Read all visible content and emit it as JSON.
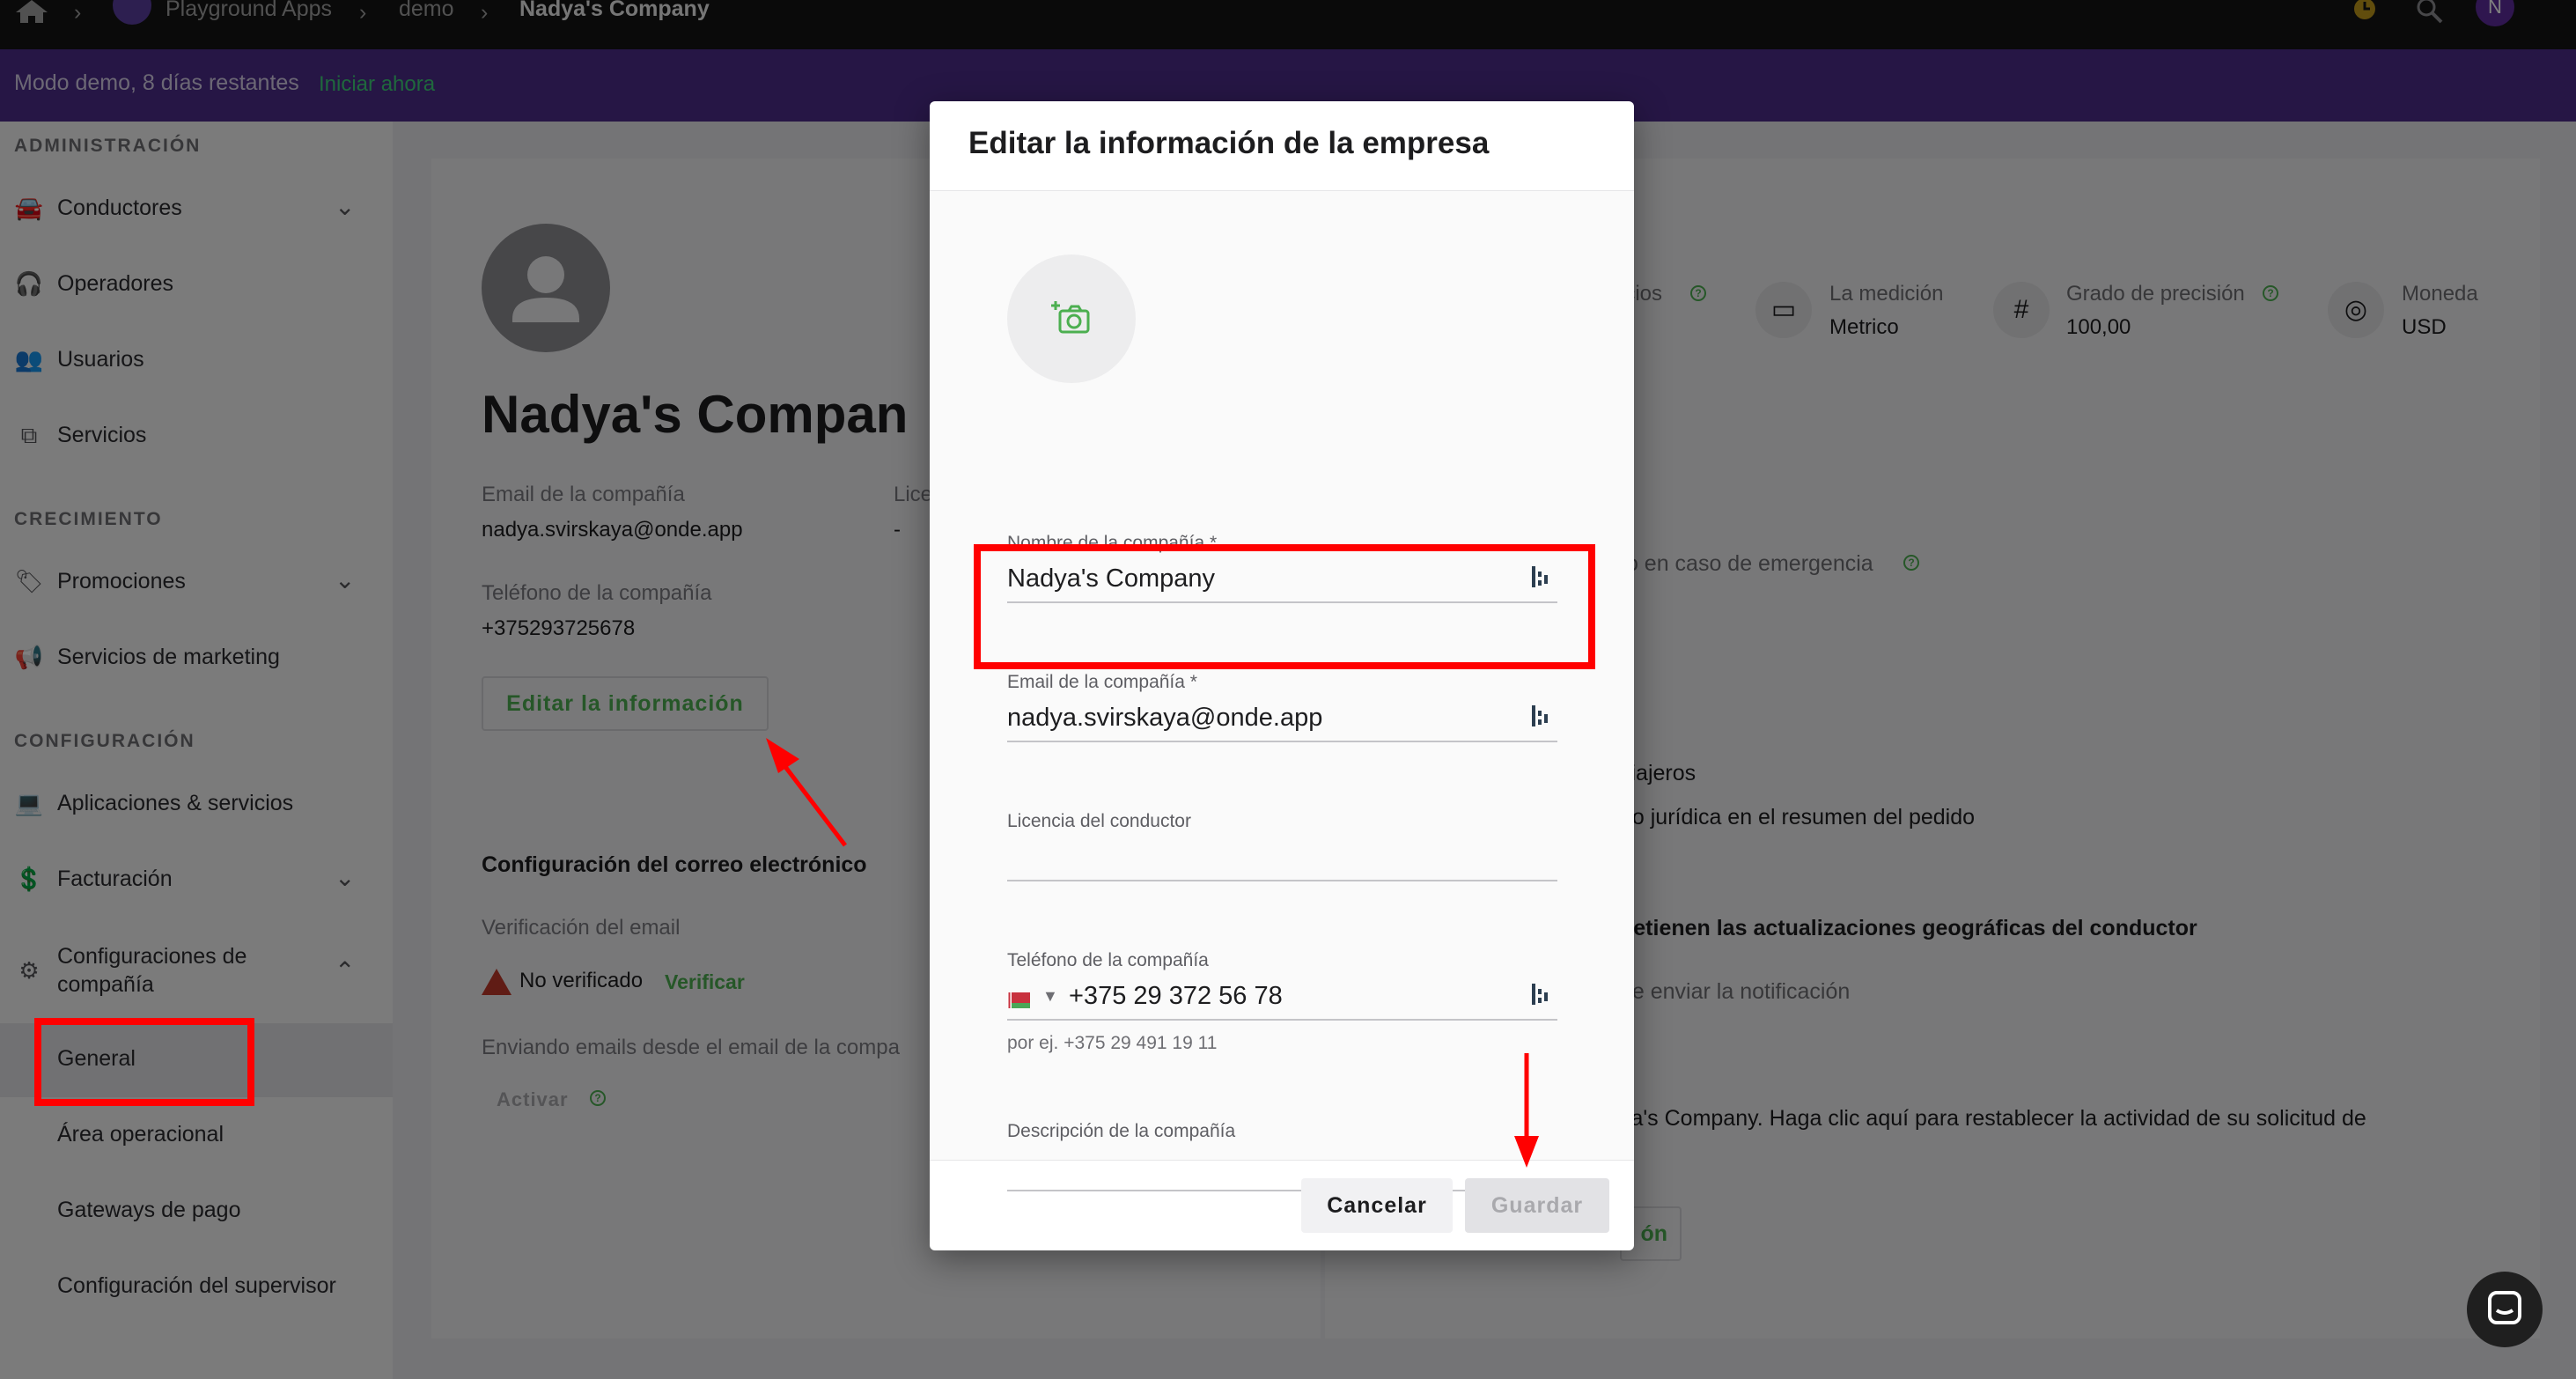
{
  "topbar": {
    "breadcrumb": [
      {
        "label": "Playground Apps"
      },
      {
        "label": "demo"
      },
      {
        "label": "Nadya's Company"
      }
    ],
    "avatar_initial": "N"
  },
  "banner": {
    "text": "Modo demo, 8 días restantes",
    "link": "Iniciar ahora"
  },
  "sidebar": {
    "sections": [
      {
        "title": "ADMINISTRACIÓN"
      },
      {
        "title": "CRECIMIENTO"
      },
      {
        "title": "CONFIGURACIÓN"
      }
    ],
    "items": {
      "conductores": "Conductores",
      "operadores": "Operadores",
      "usuarios": "Usuarios",
      "servicios": "Servicios",
      "promociones": "Promociones",
      "marketing": "Servicios de marketing",
      "aplicaciones": "Aplicaciones & servicios",
      "facturacion": "Facturación",
      "config_compania_1": "Configuraciones de",
      "config_compania_2": "compañía",
      "general": "General",
      "area": "Área operacional",
      "gateways": "Gateways de pago",
      "supervisor": "Configuración del supervisor"
    }
  },
  "page": {
    "company_name": "Nadya's Compan",
    "email_label": "Email de la compañía",
    "email_value": "nadya.svirskaya@onde.app",
    "lic_label": "Lice",
    "lic_value": "-",
    "phone_label": "Teléfono de la compañía",
    "phone_value": "+375293725678",
    "edit_button": "Editar la información",
    "email_config_title": "Configuración del correo electrónico",
    "email_verif_label": "Verificación del email",
    "not_verified": "No verificado",
    "verify_link": "Verificar",
    "sending_label": "Enviando emails desde el email de la compa",
    "activate": "Activar",
    "stats": [
      {
        "label": "icios",
        "value": ""
      },
      {
        "label": "La medición",
        "value": "Metrico"
      },
      {
        "label": "Grado de precisión",
        "value": "100,00"
      },
      {
        "label": "Moneda",
        "value": "USD"
      }
    ],
    "emergency": "to en caso de emergencia",
    "viajeros": "viajeros",
    "juridica": "no jurídica en el resumen del pedido",
    "geo": "detienen las actualizaciones geográficas del conductor",
    "notif": "de enviar la notificación",
    "reset": "ya's Company. Haga clic aquí para restablecer la actividad de su solicitud de",
    "right_btn": "ón"
  },
  "modal": {
    "title": "Editar la información de la empresa",
    "fields": [
      {
        "label": "Nombre de la compañía *",
        "value": "Nadya's Company"
      },
      {
        "label": "Email de la compañía *",
        "value": "nadya.svirskaya@onde.app"
      },
      {
        "label": "Licencia del conductor",
        "value": ""
      },
      {
        "label": "Teléfono de la compañía",
        "value": "+375 29 372 56 78",
        "help": "por ej. +375 29 491 19 11"
      },
      {
        "label": "Descripción de la compañía",
        "value": ""
      }
    ],
    "cancel": "Cancelar",
    "save": "Guardar"
  },
  "colors": {
    "accent_green": "#4caf50",
    "banner_purple": "#4c2d8a",
    "annotation_red": "#ff0000"
  },
  "icons": [
    "home-icon",
    "chevron-right-icon",
    "timer-icon",
    "search-icon",
    "camera-plus-icon",
    "autofill-icon",
    "chevron-down-icon",
    "chevron-up-icon",
    "warning-icon",
    "help-icon",
    "chat-icon"
  ]
}
